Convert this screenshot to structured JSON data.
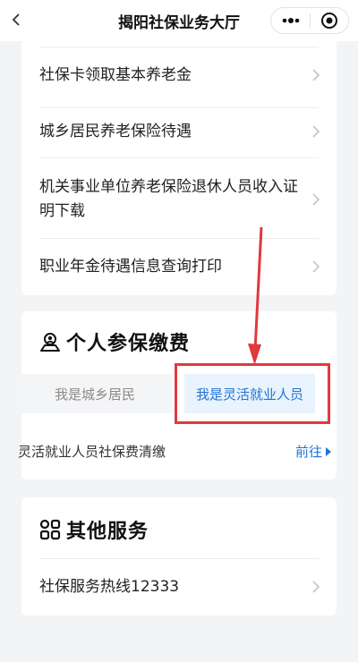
{
  "header": {
    "title": "揭阳社保业务大厅"
  },
  "list": {
    "items": [
      {
        "label": "社保卡领取基本养老金"
      },
      {
        "label": "城乡居民养老保险待遇"
      },
      {
        "label": "机关事业单位养老保险退休人员收入证明下载"
      },
      {
        "label": "职业年金待遇信息查询打印"
      }
    ]
  },
  "personal": {
    "title": "个人参保缴费",
    "tab_resident": "我是城乡居民",
    "tab_flexible": "我是灵活就业人员",
    "flexible_line": "灵活就业人员社保费清缴",
    "goto_label": "前往"
  },
  "other": {
    "title": "其他服务",
    "hotline": "社保服务热线12333"
  },
  "colors": {
    "accent": "#1f74d6",
    "highlight": "#e0393e"
  }
}
